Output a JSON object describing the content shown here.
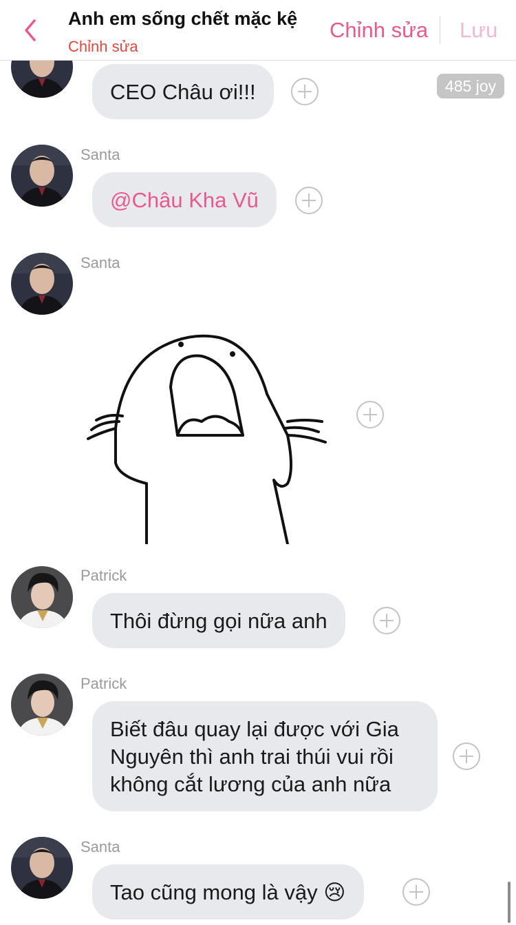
{
  "header": {
    "title": "Anh em sống chết mặc kệ",
    "subtitle": "Chỉnh sửa",
    "edit_label": "Chỉnh sửa",
    "save_label": "Lưu"
  },
  "badge": {
    "text": "485 joy"
  },
  "messages": [
    {
      "sender": "",
      "text": "CEO Châu ơi!!!"
    },
    {
      "sender": "Santa",
      "text": "@Châu Kha Vũ"
    },
    {
      "sender": "Santa",
      "text": ""
    },
    {
      "sender": "Patrick",
      "text": "Thôi đừng gọi nữa anh"
    },
    {
      "sender": "Patrick",
      "text": "Biết đâu quay lại được với Gia Nguyên thì anh trai thúi vui rồi không cắt lương của anh nữa"
    },
    {
      "sender": "Santa",
      "text": "Tao cũng mong là vậy",
      "emoji": "😢"
    }
  ],
  "colors": {
    "accent": "#e85a8b",
    "subtitle": "#e2483a",
    "bubble": "#e8e9ed",
    "save_disabled": "#f5b8cd"
  },
  "icons": {
    "back": "chevron-left-icon",
    "reaction": "plus-circle-icon"
  }
}
